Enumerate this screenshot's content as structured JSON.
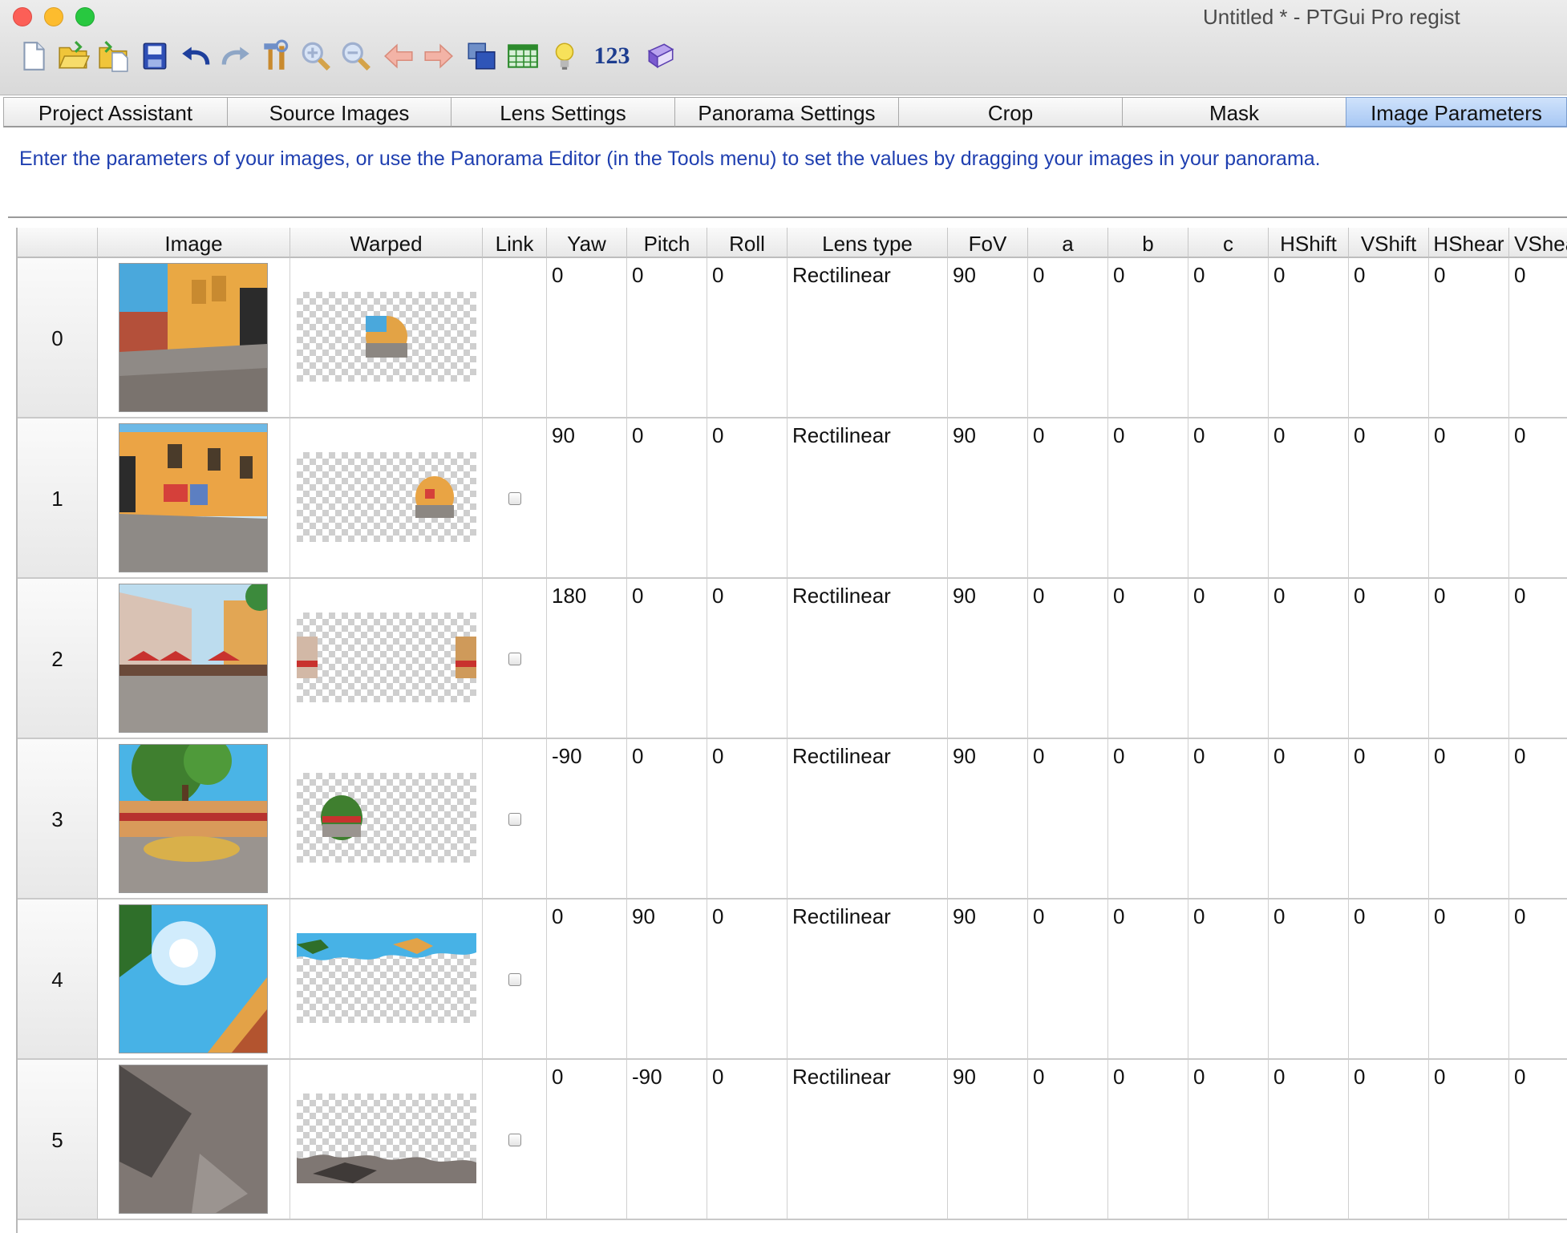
{
  "window": {
    "title": "Untitled * - PTGui Pro regist"
  },
  "toolbar": {
    "items": [
      {
        "name": "new-project",
        "icon": "document-icon"
      },
      {
        "name": "open-project",
        "icon": "folder-open-icon"
      },
      {
        "name": "open-recent",
        "icon": "folder-document-icon"
      },
      {
        "name": "save-project",
        "icon": "floppy-disk-icon"
      },
      {
        "name": "undo",
        "icon": "undo-arrow-icon"
      },
      {
        "name": "redo",
        "icon": "redo-arrow-icon"
      },
      {
        "name": "tools",
        "icon": "hammer-wrench-icon"
      },
      {
        "name": "zoom-in",
        "icon": "zoom-in-icon"
      },
      {
        "name": "zoom-out",
        "icon": "zoom-out-icon"
      },
      {
        "name": "previous",
        "icon": "arrow-left-icon"
      },
      {
        "name": "next",
        "icon": "arrow-right-icon"
      },
      {
        "name": "panorama-editor",
        "icon": "overlapping-windows-icon"
      },
      {
        "name": "table-view",
        "icon": "spreadsheet-icon"
      },
      {
        "name": "tip",
        "icon": "lightbulb-icon"
      },
      {
        "name": "numeric-transform",
        "icon": "number-123-icon",
        "label": "123"
      },
      {
        "name": "help",
        "icon": "book-icon"
      }
    ]
  },
  "tabs": [
    {
      "label": "Project Assistant",
      "active": false
    },
    {
      "label": "Source Images",
      "active": false
    },
    {
      "label": "Lens Settings",
      "active": false
    },
    {
      "label": "Panorama Settings",
      "active": false
    },
    {
      "label": "Crop",
      "active": false
    },
    {
      "label": "Mask",
      "active": false
    },
    {
      "label": "Image Parameters",
      "active": true
    }
  ],
  "hint": "Enter the parameters of your images, or use the Panorama Editor (in the Tools menu) to set the values by dragging your images in your panorama.",
  "table": {
    "columns": [
      "",
      "Image",
      "Warped",
      "Link",
      "Yaw",
      "Pitch",
      "Roll",
      "Lens type",
      "FoV",
      "a",
      "b",
      "c",
      "HShift",
      "VShift",
      "HShear",
      "VShear"
    ],
    "rows": [
      {
        "index": "0",
        "link": false,
        "show_link": false,
        "thumb": "street-facade",
        "warp": "center-blob",
        "yaw": "0",
        "pitch": "0",
        "roll": "0",
        "lens": "Rectilinear",
        "fov": "90",
        "a": "0",
        "b": "0",
        "c": "0",
        "hshift": "0",
        "vshift": "0",
        "hshear": "0",
        "vshear": "0"
      },
      {
        "index": "1",
        "link": false,
        "show_link": true,
        "thumb": "orange-building",
        "warp": "right-blob",
        "yaw": "90",
        "pitch": "0",
        "roll": "0",
        "lens": "Rectilinear",
        "fov": "90",
        "a": "0",
        "b": "0",
        "c": "0",
        "hshift": "0",
        "vshift": "0",
        "hshear": "0",
        "vshear": "0"
      },
      {
        "index": "2",
        "link": false,
        "show_link": true,
        "thumb": "plaza-umbrellas",
        "warp": "split-edges",
        "yaw": "180",
        "pitch": "0",
        "roll": "0",
        "lens": "Rectilinear",
        "fov": "90",
        "a": "0",
        "b": "0",
        "c": "0",
        "hshift": "0",
        "vshift": "0",
        "hshear": "0",
        "vshear": "0"
      },
      {
        "index": "3",
        "link": false,
        "show_link": true,
        "thumb": "tree-plaza",
        "warp": "left-blob",
        "yaw": "-90",
        "pitch": "0",
        "roll": "0",
        "lens": "Rectilinear",
        "fov": "90",
        "a": "0",
        "b": "0",
        "c": "0",
        "hshift": "0",
        "vshift": "0",
        "hshear": "0",
        "vshear": "0"
      },
      {
        "index": "4",
        "link": false,
        "show_link": true,
        "thumb": "sky-up",
        "warp": "top-band",
        "yaw": "0",
        "pitch": "90",
        "roll": "0",
        "lens": "Rectilinear",
        "fov": "90",
        "a": "0",
        "b": "0",
        "c": "0",
        "hshift": "0",
        "vshift": "0",
        "hshear": "0",
        "vshear": "0"
      },
      {
        "index": "5",
        "link": false,
        "show_link": true,
        "thumb": "ground-down",
        "warp": "bottom-band",
        "yaw": "0",
        "pitch": "-90",
        "roll": "0",
        "lens": "Rectilinear",
        "fov": "90",
        "a": "0",
        "b": "0",
        "c": "0",
        "hshift": "0",
        "vshift": "0",
        "hshear": "0",
        "vshear": "0"
      }
    ]
  },
  "colors": {
    "hint_text": "#1f3fb0",
    "active_tab": "#a8c8f4",
    "close": "#fc5f57",
    "minimize": "#fdbc2e",
    "maximize": "#28c840"
  }
}
